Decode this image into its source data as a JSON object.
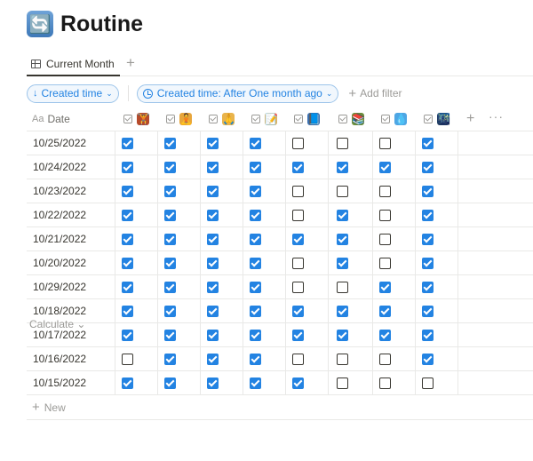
{
  "page": {
    "title": "Routine",
    "icon": "repeat-arrows-icon",
    "icon_glyph": "🔄"
  },
  "views": {
    "tabs": [
      {
        "label": "Current Month",
        "icon": "table-icon"
      }
    ],
    "add_label": "+"
  },
  "filters": {
    "sort": {
      "label": "Created time",
      "icon": "arrow-down-icon"
    },
    "filter": {
      "label": "Created time: After One month ago",
      "icon": "clock-icon"
    },
    "add_filter": "Add filter"
  },
  "table": {
    "date_header": "Date",
    "date_header_icon": "Aa",
    "columns": [
      {
        "icon": "weightlifter-icon",
        "glyph": "🏋",
        "color": "#b64a2a"
      },
      {
        "icon": "meditation-icon",
        "glyph": "🧘",
        "color": "#e7a53b"
      },
      {
        "icon": "praying-hands-icon",
        "glyph": "🙏",
        "color": "#e9b44c"
      },
      {
        "icon": "memo-icon",
        "glyph": "📝",
        "color": "#d7b46a"
      },
      {
        "icon": "blue-book-icon",
        "glyph": "📘",
        "color": "#3a6fb0"
      },
      {
        "icon": "books-icon",
        "glyph": "📚",
        "color": "#6a8d3c"
      },
      {
        "icon": "water-drop-icon",
        "glyph": "💧",
        "color": "#4ea6e4"
      },
      {
        "icon": "city-night-icon",
        "glyph": "🌃",
        "color": "#1f3d66"
      }
    ],
    "rows": [
      {
        "date": "10/25/2022",
        "checks": [
          true,
          true,
          true,
          true,
          false,
          false,
          false,
          true
        ]
      },
      {
        "date": "10/24/2022",
        "checks": [
          true,
          true,
          true,
          true,
          true,
          true,
          true,
          true
        ]
      },
      {
        "date": "10/23/2022",
        "checks": [
          true,
          true,
          true,
          true,
          false,
          false,
          false,
          true
        ]
      },
      {
        "date": "10/22/2022",
        "checks": [
          true,
          true,
          true,
          true,
          false,
          true,
          false,
          true
        ]
      },
      {
        "date": "10/21/2022",
        "checks": [
          true,
          true,
          true,
          true,
          true,
          true,
          false,
          true
        ]
      },
      {
        "date": "10/20/2022",
        "checks": [
          true,
          true,
          true,
          true,
          false,
          true,
          false,
          true
        ]
      },
      {
        "date": "10/29/2022",
        "checks": [
          true,
          true,
          true,
          true,
          false,
          false,
          true,
          true
        ]
      },
      {
        "date": "10/18/2022",
        "checks": [
          true,
          true,
          true,
          true,
          true,
          true,
          true,
          true
        ]
      },
      {
        "date": "10/17/2022",
        "checks": [
          true,
          true,
          true,
          true,
          true,
          true,
          true,
          true
        ]
      },
      {
        "date": "10/16/2022",
        "checks": [
          false,
          true,
          true,
          true,
          false,
          false,
          false,
          true
        ]
      },
      {
        "date": "10/15/2022",
        "checks": [
          true,
          true,
          true,
          true,
          true,
          false,
          false,
          false
        ]
      }
    ],
    "new_label": "New",
    "calculate_label": "Calculate"
  },
  "colors": {
    "accent": "#2383e2",
    "text": "#37352f",
    "muted": "#9b9a97",
    "border": "#e9e9e7"
  }
}
